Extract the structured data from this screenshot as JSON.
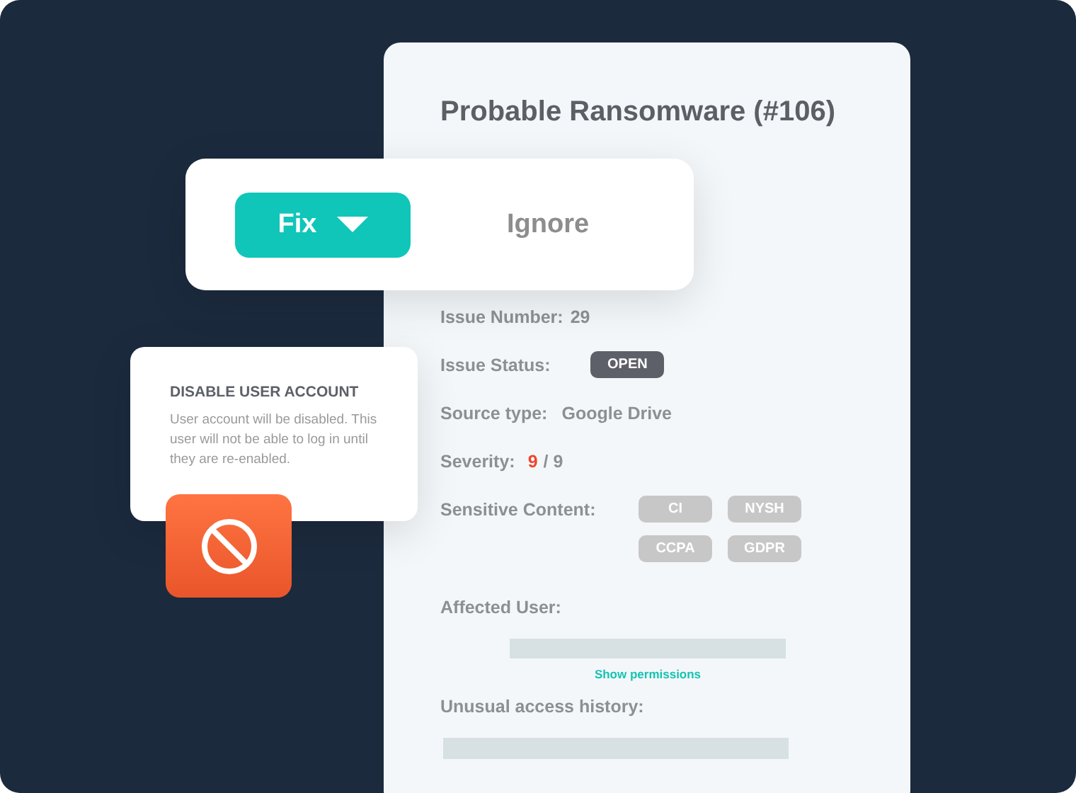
{
  "issue": {
    "title": "Probable Ransomware (#106)",
    "details": [
      {
        "kind": "text",
        "label": "Issue Number:",
        "value": "29"
      },
      {
        "kind": "badge",
        "label": "Issue Status:",
        "value": "OPEN"
      },
      {
        "kind": "text",
        "label": "Source type:",
        "value": "Google Drive"
      },
      {
        "kind": "score",
        "label": "Severity:",
        "value": "9",
        "total": "/ 9"
      },
      {
        "kind": "tags",
        "label": "Sensitive Content:",
        "tags": [
          "CI",
          "NYSH",
          "CCPA",
          "GDPR"
        ]
      }
    ],
    "affected_user": {
      "label": "Affected User:",
      "link": "Show permissions"
    },
    "access_history": {
      "label": "Unusual access history:"
    }
  },
  "actions": {
    "fix": "Fix",
    "ignore": "Ignore"
  },
  "action_popup": {
    "title": "DISABLE USER ACCOUNT",
    "text": "User account will be disabled. This user will not be able to log in until they are re-enabled."
  }
}
